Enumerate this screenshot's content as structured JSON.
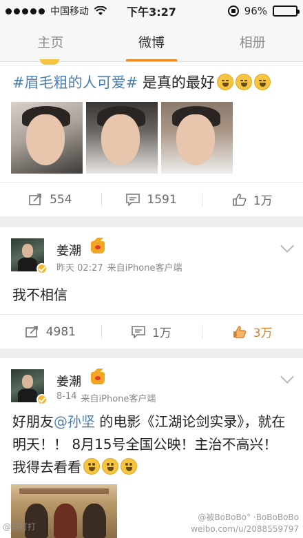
{
  "status_bar": {
    "carrier": "中国移动",
    "time": "下午3:27",
    "battery": "96%",
    "battery_level": 0.96
  },
  "tabs": [
    {
      "label": "主页",
      "active": false
    },
    {
      "label": "微博",
      "active": true
    },
    {
      "label": "相册",
      "active": false
    }
  ],
  "post1": {
    "hashtag": "#眉毛粗的人可爱#",
    "text": " 是真的最好",
    "actions": {
      "repost": "554",
      "comment": "1591",
      "like": "1万"
    }
  },
  "post2": {
    "user": "姜潮",
    "time": "昨天 02:27",
    "source": "来自iPhone客户端",
    "text": "我不相信",
    "actions": {
      "repost": "4981",
      "comment": "1万",
      "like": "3万"
    }
  },
  "post3": {
    "user": "姜潮",
    "time": "8-14",
    "source": "来自iPhone客户端",
    "text_before": "好朋友",
    "mention": "@孙坚",
    "text_after": " 的电影《江湖论剑实录》，就在明天！！ 8月15号全国公映！主治不高兴！我得去看看"
  },
  "watermark": {
    "left": "@苏打打",
    "right": "@被BoBoBo° ·BoBoBoBo",
    "url": "weibo.com/u/2088559797"
  },
  "icons": {
    "repost": "repost-icon",
    "comment": "comment-icon",
    "like": "thumbs-up-icon"
  },
  "colors": {
    "accent": "#f28a21",
    "link": "#4a7fb5",
    "liked": "#d9822b"
  }
}
